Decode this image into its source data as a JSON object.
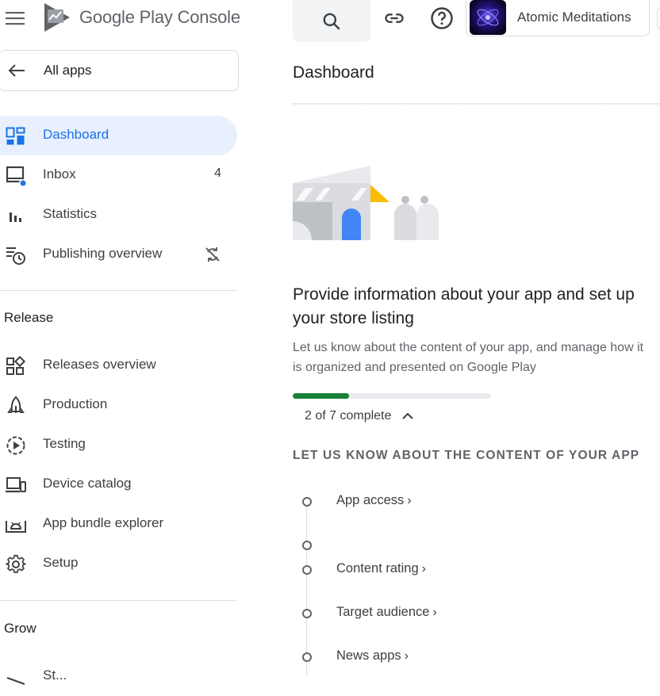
{
  "brand": {
    "name_part1": "Google Play",
    "name_part2": "Console"
  },
  "topbar": {
    "app_name": "Atomic Meditations"
  },
  "sidebar": {
    "all_apps": "All apps",
    "items": [
      {
        "label": "Dashboard"
      },
      {
        "label": "Inbox",
        "count": "4"
      },
      {
        "label": "Statistics"
      },
      {
        "label": "Publishing overview"
      }
    ],
    "sections": [
      {
        "title": "Release",
        "items": [
          {
            "label": "Releases overview"
          },
          {
            "label": "Production"
          },
          {
            "label": "Testing"
          },
          {
            "label": "Device catalog"
          },
          {
            "label": "App bundle explorer"
          },
          {
            "label": "Setup"
          }
        ]
      },
      {
        "title": "Grow",
        "items": [
          {
            "label": "St..."
          }
        ]
      }
    ]
  },
  "main": {
    "title": "Dashboard",
    "headline": "Provide information about your app and set up your store listing",
    "subtext": "Let us know about the content of your app, and manage how it is organized and presented on Google Play",
    "progress": {
      "completed": 2,
      "total": 7,
      "label": "2 of 7 complete"
    },
    "section_caption": "LET US KNOW ABOUT THE CONTENT OF YOUR APP",
    "steps": [
      {
        "label": "App access"
      },
      {
        "label": ""
      },
      {
        "label": "Content rating"
      },
      {
        "label": "Target audience"
      },
      {
        "label": "News apps"
      }
    ]
  },
  "colors": {
    "accent": "#1a73e8",
    "active_bg": "#e8f0fe",
    "progress": "#188038",
    "illustration_yellow": "#fbbc04"
  }
}
